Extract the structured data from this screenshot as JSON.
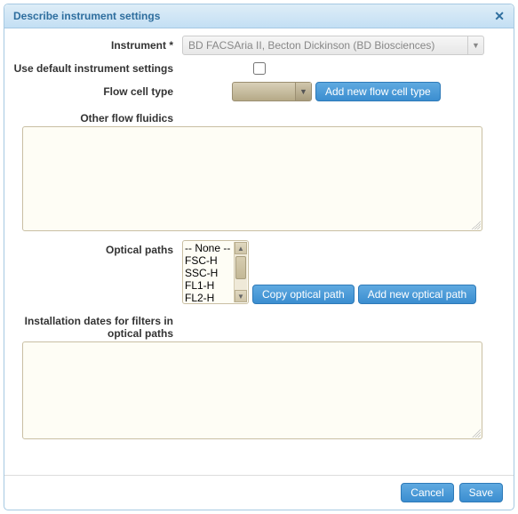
{
  "dialog": {
    "title": "Describe instrument settings",
    "close_tooltip": "Close"
  },
  "labels": {
    "instrument": "Instrument *",
    "use_default": "Use default instrument settings",
    "flow_cell_type": "Flow cell type",
    "other_flow_fluidics": "Other flow fluidics",
    "optical_paths": "Optical paths",
    "installation_dates": "Installation dates for filters in optical paths"
  },
  "fields": {
    "instrument_value": "BD FACSAria II, Becton Dickinson (BD Biosciences)",
    "use_default_checked": false,
    "flow_cell_type_value": "",
    "other_flow_fluidics_value": "",
    "installation_dates_value": "",
    "optical_paths_options": [
      "-- None --",
      "FSC-H",
      "SSC-H",
      "FL1-H",
      "FL2-H"
    ]
  },
  "buttons": {
    "add_flow_cell": "Add new flow cell type",
    "copy_optical": "Copy optical path",
    "add_optical": "Add new optical path",
    "cancel": "Cancel",
    "save": "Save"
  }
}
